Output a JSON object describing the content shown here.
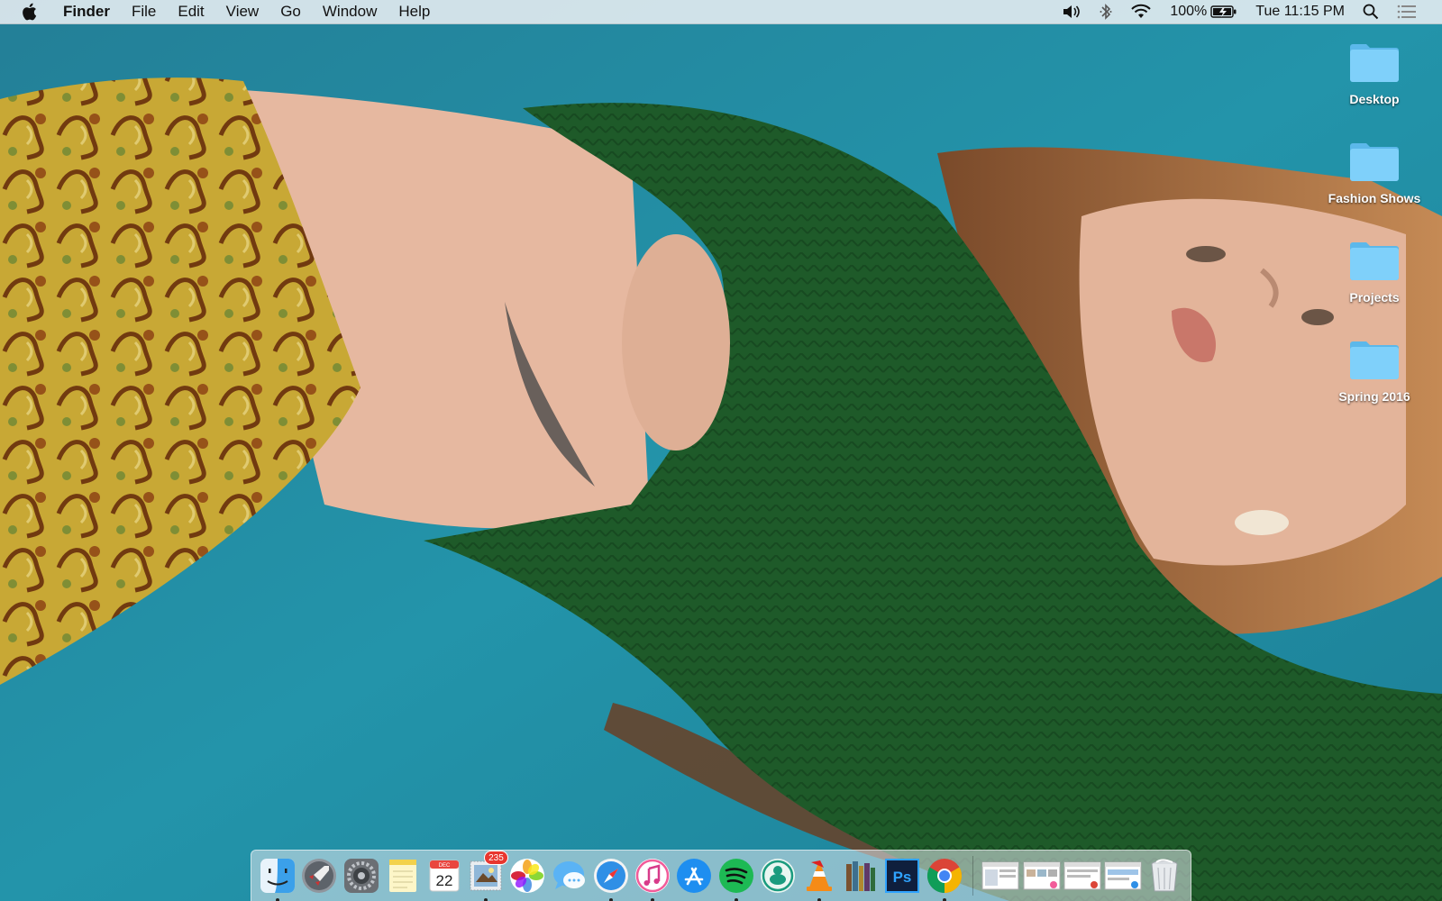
{
  "menubar": {
    "apple_icon": "apple-logo-icon",
    "app_name": "Finder",
    "items": [
      "File",
      "Edit",
      "View",
      "Go",
      "Window",
      "Help"
    ],
    "status": {
      "battery_percent": "100%",
      "clock": "Tue 11:15 PM",
      "icons": [
        "volume-icon",
        "bluetooth-icon",
        "wifi-icon",
        "battery-charging-icon",
        "spotlight-search-icon",
        "notification-center-icon"
      ]
    }
  },
  "desktop": {
    "folders": [
      {
        "label": "Desktop"
      },
      {
        "label": "Fashion Shows"
      },
      {
        "label": "Projects"
      },
      {
        "label": "Spring 2016"
      }
    ]
  },
  "dock": {
    "apps": [
      {
        "name": "finder",
        "running": true
      },
      {
        "name": "launchpad",
        "running": false
      },
      {
        "name": "system-preferences",
        "running": false
      },
      {
        "name": "notes",
        "running": false
      },
      {
        "name": "calendar",
        "running": false,
        "month": "DEC",
        "day": "22"
      },
      {
        "name": "mail",
        "running": true,
        "badge": "235"
      },
      {
        "name": "photos",
        "running": false
      },
      {
        "name": "messages",
        "running": false
      },
      {
        "name": "safari",
        "running": true
      },
      {
        "name": "itunes",
        "running": true
      },
      {
        "name": "app-store",
        "running": false
      },
      {
        "name": "spotify",
        "running": true
      },
      {
        "name": "cyberduck",
        "running": false
      },
      {
        "name": "vlc",
        "running": true
      },
      {
        "name": "ibooks",
        "running": false
      },
      {
        "name": "photoshop",
        "running": false,
        "label": "Ps"
      },
      {
        "name": "chrome",
        "running": true
      }
    ],
    "minimized_windows": 4,
    "trash": "trash-icon"
  },
  "colors": {
    "wallpaper_bg": "#1f8ea6",
    "sweater_green": "#1f5e2a",
    "folder_blue": "#6fc8f5"
  }
}
